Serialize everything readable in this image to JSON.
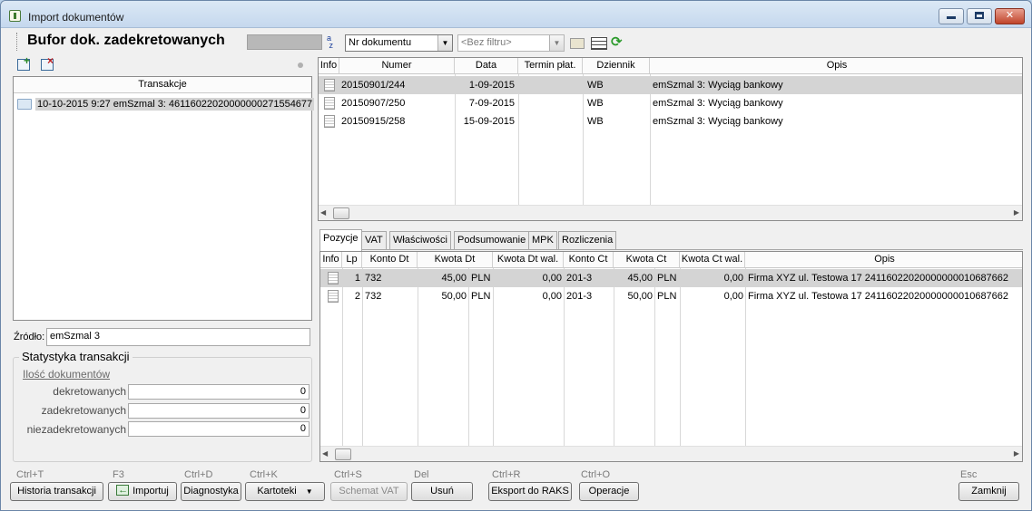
{
  "window": {
    "title": "Import dokumentów",
    "icon": "app-icon"
  },
  "toolbar": {
    "title": "Bufor dok. zadekretowanych",
    "sort_field": "Nr dokumentu",
    "filter_placeholder": "<Bez filtru>",
    "icons": [
      "sort-az-icon",
      "folder-icon",
      "grid-view-icon",
      "refresh-icon"
    ]
  },
  "left": {
    "tree_header": "Transakcje",
    "tree_items": [
      {
        "label": "10-10-2015  9:27 emSzmal 3: 46116022020000000271554677"
      }
    ],
    "source_label": "Źródło:",
    "source_value": "emSzmal 3",
    "stats_title": "Statystyka transakcji",
    "docs_link": "Ilość dokumentów",
    "stats": [
      {
        "label": "dekretowanych",
        "value": "0"
      },
      {
        "label": "zadekretowanych",
        "value": "0"
      },
      {
        "label": "niezadekretowanych",
        "value": "0"
      }
    ]
  },
  "documents": {
    "columns": [
      "Info",
      "Numer",
      "Data",
      "Termin płat.",
      "Dziennik",
      "Opis"
    ],
    "rows": [
      {
        "numer": "20150901/244",
        "data": "1-09-2015",
        "termin": "",
        "dziennik": "WB",
        "opis": "emSzmal 3: Wyciąg bankowy"
      },
      {
        "numer": "20150907/250",
        "data": "7-09-2015",
        "termin": "",
        "dziennik": "WB",
        "opis": "emSzmal 3: Wyciąg bankowy"
      },
      {
        "numer": "20150915/258",
        "data": "15-09-2015",
        "termin": "",
        "dziennik": "WB",
        "opis": "emSzmal 3: Wyciąg bankowy"
      }
    ]
  },
  "tabs": [
    "Pozycje",
    "VAT",
    "Właściwości",
    "Podsumowanie",
    "MPK",
    "Rozliczenia"
  ],
  "positions": {
    "columns": [
      "Info",
      "Lp",
      "Konto Dt",
      "Kwota Dt",
      "Kwota Dt wal.",
      "Konto Ct",
      "Kwota Ct",
      "Kwota Ct wal.",
      "Opis"
    ],
    "rows": [
      {
        "lp": "1",
        "konto_dt": "732",
        "kwota_dt": "45,00",
        "waluta_dt": "PLN",
        "kwota_dt_wal": "0,00",
        "konto_ct": "201-3",
        "kwota_ct": "45,00",
        "waluta_ct": "PLN",
        "kwota_ct_wal": "0,00",
        "opis": "Firma XYZ ul. Testowa 17 24116022020000000010687662"
      },
      {
        "lp": "2",
        "konto_dt": "732",
        "kwota_dt": "50,00",
        "waluta_dt": "PLN",
        "kwota_dt_wal": "0,00",
        "konto_ct": "201-3",
        "kwota_ct": "50,00",
        "waluta_ct": "PLN",
        "kwota_ct_wal": "0,00",
        "opis": "Firma XYZ ul. Testowa 17 24116022020000000010687662"
      }
    ]
  },
  "buttons": [
    {
      "shortcut": "Ctrl+T",
      "label": "Historia transakcji"
    },
    {
      "shortcut": "F3",
      "label": "Importuj"
    },
    {
      "shortcut": "Ctrl+D",
      "label": "Diagnostyka"
    },
    {
      "shortcut": "Ctrl+K",
      "label": "Kartoteki"
    },
    {
      "shortcut": "Ctrl+S",
      "label": "Schemat VAT"
    },
    {
      "shortcut": "Del",
      "label": "Usuń"
    },
    {
      "shortcut": "Ctrl+R",
      "label": "Eksport do RAKS"
    },
    {
      "shortcut": "Ctrl+O",
      "label": "Operacje"
    },
    {
      "shortcut": "Esc",
      "label": "Zamknij"
    }
  ]
}
